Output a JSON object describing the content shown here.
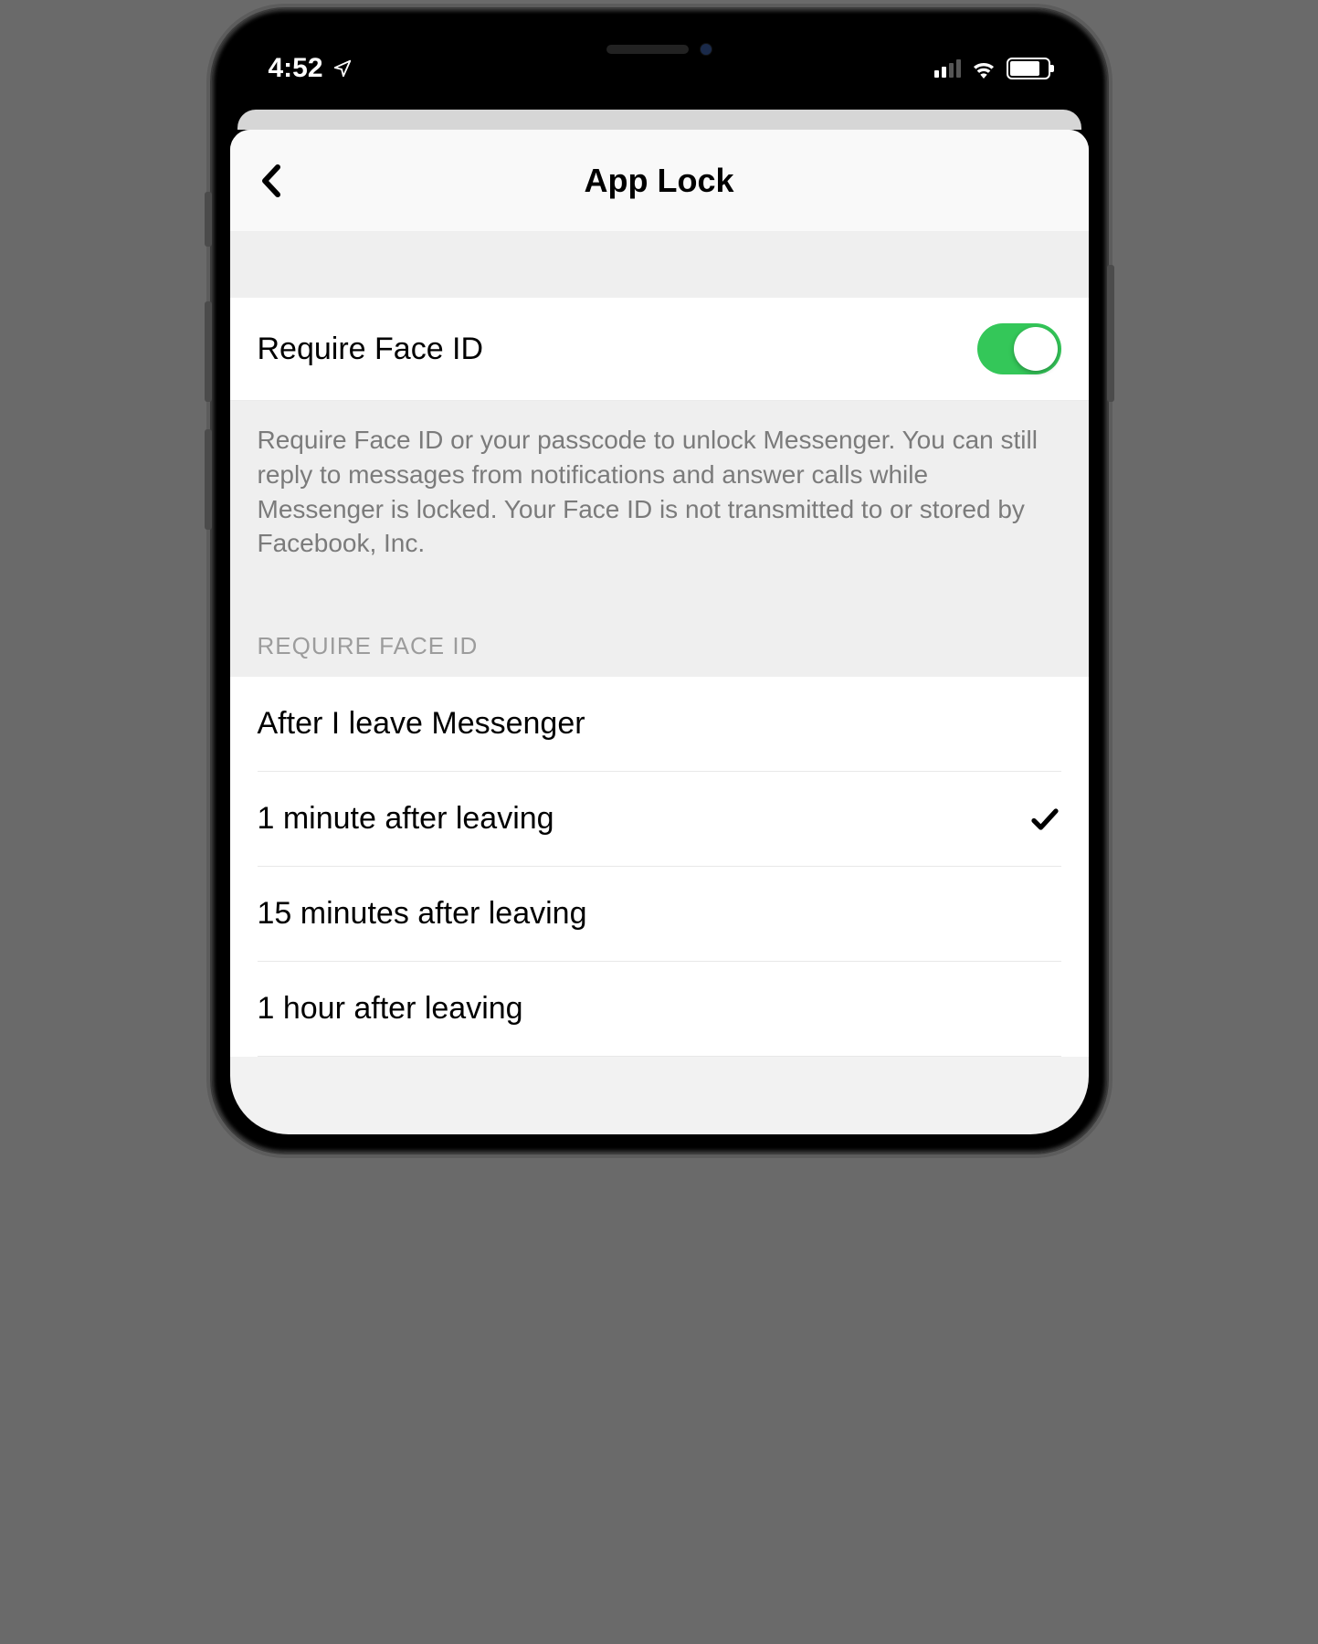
{
  "statusbar": {
    "time": "4:52"
  },
  "header": {
    "title": "App Lock"
  },
  "faceid": {
    "label": "Require Face ID",
    "enabled": true,
    "description": "Require Face ID or your passcode to unlock Messenger. You can still reply to messages from notifications and answer calls while Messenger is locked. Your Face ID is not transmitted to or stored by Facebook, Inc."
  },
  "timing": {
    "section_title": "REQUIRE FACE ID",
    "selected_index": 1,
    "options": [
      {
        "label": "After I leave Messenger"
      },
      {
        "label": "1 minute after leaving"
      },
      {
        "label": "15 minutes after leaving"
      },
      {
        "label": "1 hour after leaving"
      }
    ]
  }
}
